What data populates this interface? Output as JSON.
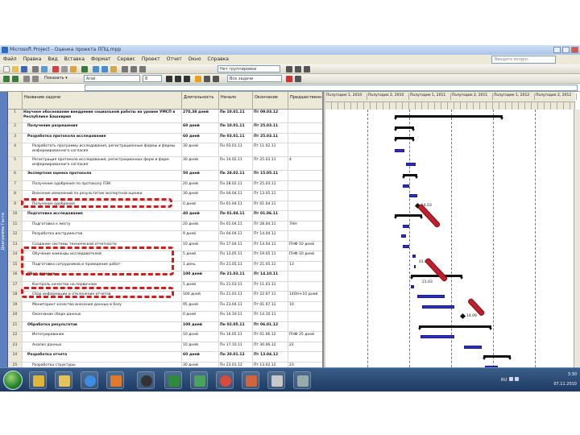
{
  "window": {
    "title": "Microsoft Project - Оценка проекта ЛПЦ.mpp"
  },
  "menu": [
    "Файл",
    "Правка",
    "Вид",
    "Вставка",
    "Формат",
    "Сервис",
    "Проект",
    "Отчет",
    "Окно",
    "Справка"
  ],
  "help_placeholder": "Введите вопрос",
  "toolbar": {
    "group_value": "Нет группировки",
    "font_name": "Arial",
    "font_size": "8",
    "filter_value": "Все задачи"
  },
  "viewbar_label": "Диаграмма Ганта",
  "columns": [
    "",
    "Название задачи",
    "Длительность",
    "Начало",
    "Окончание",
    "Предшественн"
  ],
  "rows": [
    {
      "id": "1",
      "name": "Научное обоснование внедрения социальной работы на уровне УМСП в Республике Башкирия",
      "dur": "270,38 дней",
      "start": "Пн 10.01.11",
      "end": "Пт 09.03.12",
      "pred": "",
      "bold": true,
      "h": 2
    },
    {
      "id": "2",
      "name": "Получение разрешения",
      "dur": "60 дней",
      "start": "Пн 10.01.11",
      "end": "Пт 25.03.11",
      "pred": "",
      "bold": true,
      "h": 1
    },
    {
      "id": "3",
      "name": "Разработка протокола исследования",
      "dur": "60 дней",
      "start": "Пн 03.01.11",
      "end": "Пт 25.03.11",
      "pred": "",
      "bold": true,
      "h": 1
    },
    {
      "id": "4",
      "name": "Разработать программу исследования, регистрационные формы и формы информированного согласия",
      "dur": "30 дней",
      "start": "Пн 03.01.11",
      "end": "Пт 11.02.11",
      "pred": "",
      "bold": false,
      "h": 2
    },
    {
      "id": "5",
      "name": "Регистрация протокола исследования, регистрационных форм и форм информированного согласия",
      "dur": "30 дней",
      "start": "Пн 14.02.11",
      "end": "Пт 25.03.11",
      "pred": "4",
      "bold": false,
      "h": 2
    },
    {
      "id": "6",
      "name": "Экспертная оценка протокола",
      "dur": "50 дней",
      "start": "Пн 28.02.11",
      "end": "Пт 15.05.11",
      "pred": "",
      "bold": true,
      "h": 1
    },
    {
      "id": "7",
      "name": "Получение одобрения по протоколу ЛЭК",
      "dur": "20 дней",
      "start": "Пн 28.02.11",
      "end": "Пт 25.03.11",
      "pred": "",
      "bold": false,
      "h": 1
    },
    {
      "id": "8",
      "name": "Внесение изменений по результатам экспертной оценки",
      "dur": "30 дней",
      "start": "Пн 04.04.11",
      "end": "Пт 13.05.11",
      "pred": "",
      "bold": false,
      "h": 1
    },
    {
      "id": "9",
      "name": "Получение одобрения",
      "dur": "0 дней",
      "start": "Пн 01.04.11",
      "end": "Пт 01.04.11",
      "pred": "",
      "bold": false,
      "h": 1
    },
    {
      "id": "10",
      "name": "Подготовка исследования",
      "dur": "40 дней",
      "start": "Пн 01.04.11",
      "end": "Пт 01.06.11",
      "pred": "",
      "bold": true,
      "h": 1
    },
    {
      "id": "11",
      "name": "Подготовка к месту",
      "dur": "20 дней",
      "start": "Пн 01.04.11",
      "end": "Пт 28.04.11",
      "pred": "7НН",
      "bold": false,
      "h": 1
    },
    {
      "id": "12",
      "name": "Разработка инструментов",
      "dur": "9 дней",
      "start": "Пн 04.04.11",
      "end": "Пт 14.04.11",
      "pred": "",
      "bold": false,
      "h": 1
    },
    {
      "id": "13",
      "name": "Создание системы технической отчетности",
      "dur": "10 дней",
      "start": "Пн 17.04.11",
      "end": "Пт 14.04.11",
      "pred": "ПНФ 10 дней",
      "bold": false,
      "h": 1
    },
    {
      "id": "14",
      "name": "Обучение команды исследователей",
      "dur": "5 дней",
      "start": "Пн 13.05.11",
      "end": "Пт 19.05.11",
      "pred": "ПНФ 10 дней",
      "bold": false,
      "h": 1
    },
    {
      "id": "15",
      "name": "Подготовка сотрудников и проведение работ",
      "dur": "1 день",
      "start": "Пн 21.05.11",
      "end": "Пт 21.05.11",
      "pred": "13",
      "bold": false,
      "h": 1
    },
    {
      "id": "16",
      "name": "Сбор данных",
      "dur": "100 дней",
      "start": "Пн 21.03.11",
      "end": "Пт 14.10.11",
      "pred": "",
      "bold": true,
      "h": 1
    },
    {
      "id": "17",
      "name": "Контроль качества на первичном",
      "dur": "5 дней",
      "start": "Пн 21.03.11",
      "end": "Пт 11.03.11",
      "pred": "",
      "bold": false,
      "h": 1
    },
    {
      "id": "18",
      "name": "Сбор информации и отклонение отчетов",
      "dur": "100 дней",
      "start": "Пн 21.03.11",
      "end": "Пт 22.07.11",
      "pred": "14ОН+10 дней",
      "bold": false,
      "h": 1
    },
    {
      "id": "19",
      "name": "Мониторинг качества внесения данных в базу",
      "dur": "95 дней",
      "start": "Пн 23.04.11",
      "end": "Пт 01.07.11",
      "pred": "10",
      "bold": false,
      "h": 1
    },
    {
      "id": "20",
      "name": "Окончание сбора данных",
      "dur": "0 дней",
      "start": "Пн 14.10.11",
      "end": "Пт 14.10.11",
      "pred": "",
      "bold": false,
      "h": 1
    },
    {
      "id": "21",
      "name": "Обработка результатов",
      "dur": "100 дней",
      "start": "Пн 02.05.11",
      "end": "Пт 06.01.12",
      "pred": "",
      "bold": true,
      "h": 1
    },
    {
      "id": "22",
      "name": "Интегрирование",
      "dur": "10 дней",
      "start": "Пн 16.05.11",
      "end": "Пт 01.06.12",
      "pred": "ПНФ 25 дней",
      "bold": false,
      "h": 1
    },
    {
      "id": "23",
      "name": "Анализ данных",
      "dur": "10 дней",
      "start": "Пн 17.10.11",
      "end": "Пт 30.06.12",
      "pred": "22",
      "bold": false,
      "h": 1
    },
    {
      "id": "24",
      "name": "Разработка отчета",
      "dur": "60 дней",
      "start": "Пн 20.01.12",
      "end": "Пт 13.04.12",
      "pred": "",
      "bold": true,
      "h": 1
    },
    {
      "id": "25",
      "name": "Разработка структуры",
      "dur": "30 дней",
      "start": "Пн 23.01.12",
      "end": "Пт 13.02.12",
      "pred": "23",
      "bold": false,
      "h": 1
    },
    {
      "id": "26",
      "name": "Разработка финального",
      "dur": "20 дней",
      "start": "Пн 20.02.12",
      "end": "Пт 13.04.12",
      "pred": "",
      "bold": false,
      "h": 1
    }
  ],
  "gantt": {
    "periods": [
      "Полугодие 1, 2010",
      "Полугодие 2, 2010",
      "Полугодие 1, 2011",
      "Полугодие 2, 2011",
      "Полугодие 1, 2012",
      "Полугодие 2, 2012"
    ],
    "milestones": [
      "14.03",
      "01.01",
      "21.03",
      "14.09"
    ]
  },
  "taskbar": {
    "time": "3:30",
    "date": "07.11.2010",
    "lang": "RU"
  }
}
